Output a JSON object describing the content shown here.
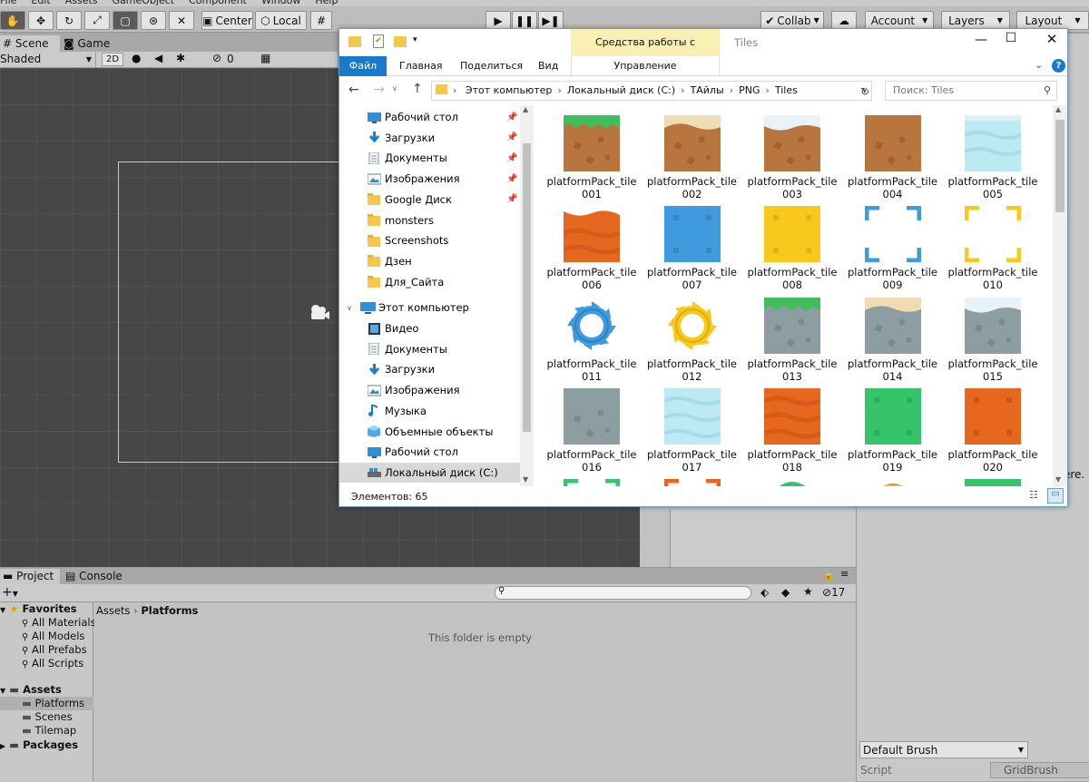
{
  "unity": {
    "menus": [
      "File",
      "Edit",
      "Assets",
      "GameObject",
      "Component",
      "Window",
      "Help"
    ],
    "toolbar": {
      "center": "Center",
      "local": "Local",
      "collab": "Collab",
      "account": "Account",
      "layers": "Layers",
      "layout": "Layout"
    },
    "scene_tabs": [
      "Scene",
      "Game"
    ],
    "shading_mode": "Shaded",
    "mode_2d": "2D",
    "hidden_count": "0",
    "project": {
      "tabs": [
        "Project",
        "Console"
      ],
      "favorites_label": "Favorites",
      "favorites": [
        "All Materials",
        "All Models",
        "All Prefabs",
        "All Scripts"
      ],
      "assets_label": "Assets",
      "assets_children": [
        "Platforms",
        "Scenes",
        "Tilemap"
      ],
      "packages_label": "Packages",
      "breadcrumb": [
        "Assets",
        "Platforms"
      ],
      "empty_msg": "This folder is empty",
      "hidden_badge": "17"
    },
    "inspector": {
      "truncated_text": "ere.",
      "brush": "Default Brush",
      "script_label": "Script",
      "script_value": "GridBrush"
    }
  },
  "explorer": {
    "title": "Tiles",
    "context_tab": "Средства работы с рисунками",
    "ribbon_tabs": [
      "Файл",
      "Главная",
      "Поделиться",
      "Вид"
    ],
    "context_sub": "Управление",
    "path": [
      "Этот компьютер",
      "Локальный диск (C:)",
      "ТАйлы",
      "PNG",
      "Tiles"
    ],
    "search_placeholder": "Поиск: Tiles",
    "nav": {
      "quick": [
        {
          "label": "Рабочий стол",
          "icon": "desktop-icon",
          "pinned": true
        },
        {
          "label": "Загрузки",
          "icon": "downloads-icon",
          "pinned": true
        },
        {
          "label": "Документы",
          "icon": "documents-icon",
          "pinned": true
        },
        {
          "label": "Изображения",
          "icon": "pictures-icon",
          "pinned": true
        },
        {
          "label": "Google Диск",
          "icon": "folder-icon",
          "pinned": true
        },
        {
          "label": "monsters",
          "icon": "folder-icon",
          "pinned": false
        },
        {
          "label": "Screenshots",
          "icon": "folder-icon",
          "pinned": false
        },
        {
          "label": "Дзен",
          "icon": "folder-icon",
          "pinned": false
        },
        {
          "label": "Для_Сайта",
          "icon": "folder-icon",
          "pinned": false
        }
      ],
      "this_pc": "Этот компьютер",
      "pc_items": [
        {
          "label": "Видео",
          "icon": "video-icon"
        },
        {
          "label": "Документы",
          "icon": "documents-icon"
        },
        {
          "label": "Загрузки",
          "icon": "downloads-icon"
        },
        {
          "label": "Изображения",
          "icon": "pictures-icon"
        },
        {
          "label": "Музыка",
          "icon": "music-icon"
        },
        {
          "label": "Объемные объекты",
          "icon": "3d-objects-icon"
        },
        {
          "label": "Рабочий стол",
          "icon": "desktop-icon"
        },
        {
          "label": "Локальный диск (C:)",
          "icon": "drive-icon"
        }
      ]
    },
    "files": [
      {
        "name": "platformPack_tile",
        "num": "001",
        "kind": "grass"
      },
      {
        "name": "platformPack_tile",
        "num": "002",
        "kind": "sand"
      },
      {
        "name": "platformPack_tile",
        "num": "003",
        "kind": "snowdirt"
      },
      {
        "name": "platformPack_tile",
        "num": "004",
        "kind": "dirt"
      },
      {
        "name": "platformPack_tile",
        "num": "005",
        "kind": "water"
      },
      {
        "name": "platformPack_tile",
        "num": "006",
        "kind": "lava"
      },
      {
        "name": "platformPack_tile",
        "num": "007",
        "kind": "blue"
      },
      {
        "name": "platformPack_tile",
        "num": "008",
        "kind": "yellow"
      },
      {
        "name": "platformPack_tile",
        "num": "009",
        "kind": "frameblue"
      },
      {
        "name": "platformPack_tile",
        "num": "010",
        "kind": "frameyellow"
      },
      {
        "name": "platformPack_tile",
        "num": "011",
        "kind": "sawblue"
      },
      {
        "name": "platformPack_tile",
        "num": "012",
        "kind": "sawyellow"
      },
      {
        "name": "platformPack_tile",
        "num": "013",
        "kind": "grassstone"
      },
      {
        "name": "platformPack_tile",
        "num": "014",
        "kind": "sandstone"
      },
      {
        "name": "platformPack_tile",
        "num": "015",
        "kind": "snowstone"
      },
      {
        "name": "platformPack_tile",
        "num": "016",
        "kind": "stone"
      },
      {
        "name": "platformPack_tile",
        "num": "017",
        "kind": "waterfull"
      },
      {
        "name": "platformPack_tile",
        "num": "018",
        "kind": "lavafull"
      },
      {
        "name": "platformPack_tile",
        "num": "019",
        "kind": "green"
      },
      {
        "name": "platformPack_tile",
        "num": "020",
        "kind": "orange"
      },
      {
        "name": "",
        "num": "",
        "kind": "framegreen"
      },
      {
        "name": "",
        "num": "",
        "kind": "frameorange"
      },
      {
        "name": "",
        "num": "",
        "kind": "partialblue"
      },
      {
        "name": "",
        "num": "",
        "kind": "partialorange"
      },
      {
        "name": "",
        "num": "",
        "kind": "partialgreen"
      }
    ],
    "status": "Элементов: 65"
  }
}
